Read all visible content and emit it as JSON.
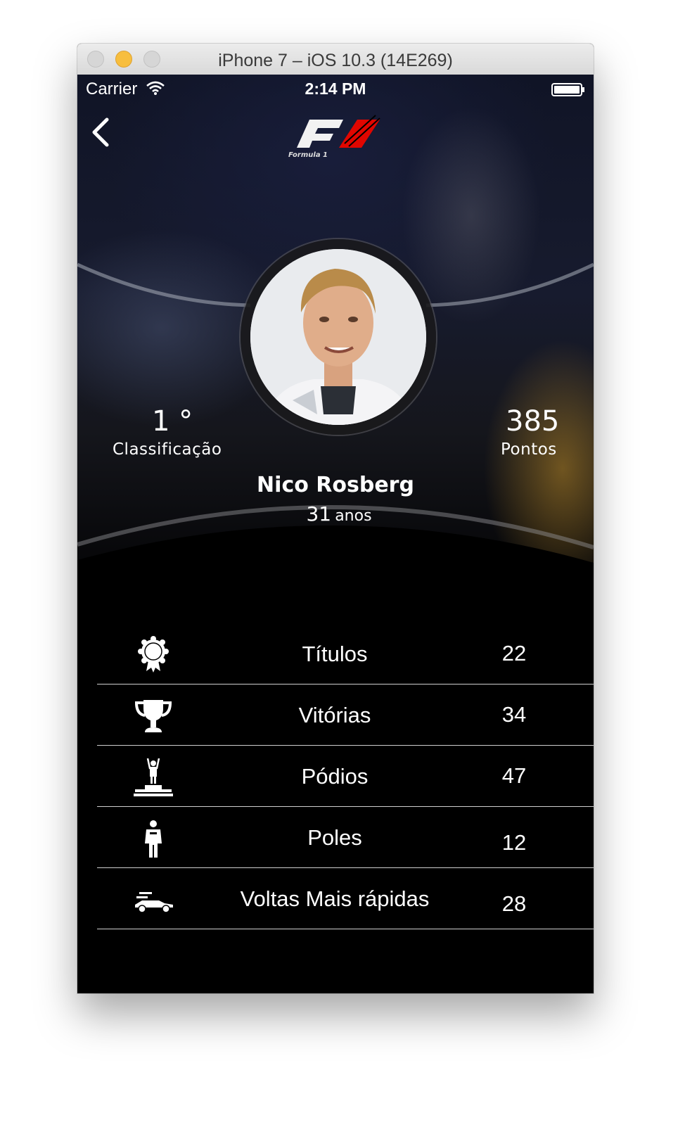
{
  "window": {
    "title": "iPhone 7 – iOS 10.3 (14E269)"
  },
  "status_bar": {
    "carrier": "Carrier",
    "time": "2:14 PM"
  },
  "header": {
    "logo_text": "Formula 1"
  },
  "driver": {
    "name": "Nico Rosberg",
    "age": "31",
    "age_unit": "anos",
    "position": "1 °",
    "position_label": "Classificação",
    "points": "385",
    "points_label": "Pontos"
  },
  "stats": [
    {
      "icon": "award-ribbon-icon",
      "label": "Títulos",
      "value": "22"
    },
    {
      "icon": "trophy-icon",
      "label": "Vitórias",
      "value": "34"
    },
    {
      "icon": "podium-icon",
      "label": "Pódios",
      "value": "47"
    },
    {
      "icon": "driver-icon",
      "label": "Poles",
      "value": "12"
    },
    {
      "icon": "race-car-icon",
      "label": "Voltas Mais rápidas",
      "value": "28"
    }
  ],
  "colors": {
    "background": "#000000",
    "text": "#ffffff",
    "f1_red": "#e10600",
    "divider": "#cfcfcf"
  }
}
